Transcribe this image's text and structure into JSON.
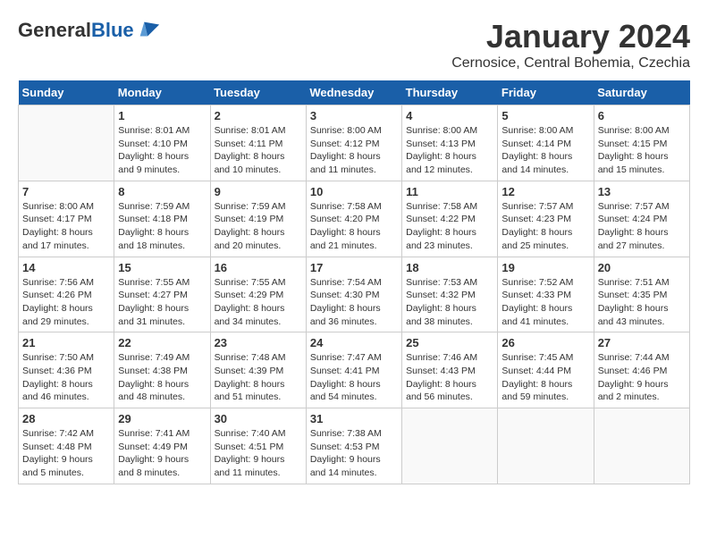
{
  "header": {
    "logo_line1": "General",
    "logo_line2": "Blue",
    "month": "January 2024",
    "location": "Cernosice, Central Bohemia, Czechia"
  },
  "days_of_week": [
    "Sunday",
    "Monday",
    "Tuesday",
    "Wednesday",
    "Thursday",
    "Friday",
    "Saturday"
  ],
  "weeks": [
    [
      {
        "day": "",
        "info": ""
      },
      {
        "day": "1",
        "info": "Sunrise: 8:01 AM\nSunset: 4:10 PM\nDaylight: 8 hours\nand 9 minutes."
      },
      {
        "day": "2",
        "info": "Sunrise: 8:01 AM\nSunset: 4:11 PM\nDaylight: 8 hours\nand 10 minutes."
      },
      {
        "day": "3",
        "info": "Sunrise: 8:00 AM\nSunset: 4:12 PM\nDaylight: 8 hours\nand 11 minutes."
      },
      {
        "day": "4",
        "info": "Sunrise: 8:00 AM\nSunset: 4:13 PM\nDaylight: 8 hours\nand 12 minutes."
      },
      {
        "day": "5",
        "info": "Sunrise: 8:00 AM\nSunset: 4:14 PM\nDaylight: 8 hours\nand 14 minutes."
      },
      {
        "day": "6",
        "info": "Sunrise: 8:00 AM\nSunset: 4:15 PM\nDaylight: 8 hours\nand 15 minutes."
      }
    ],
    [
      {
        "day": "7",
        "info": "Sunrise: 8:00 AM\nSunset: 4:17 PM\nDaylight: 8 hours\nand 17 minutes."
      },
      {
        "day": "8",
        "info": "Sunrise: 7:59 AM\nSunset: 4:18 PM\nDaylight: 8 hours\nand 18 minutes."
      },
      {
        "day": "9",
        "info": "Sunrise: 7:59 AM\nSunset: 4:19 PM\nDaylight: 8 hours\nand 20 minutes."
      },
      {
        "day": "10",
        "info": "Sunrise: 7:58 AM\nSunset: 4:20 PM\nDaylight: 8 hours\nand 21 minutes."
      },
      {
        "day": "11",
        "info": "Sunrise: 7:58 AM\nSunset: 4:22 PM\nDaylight: 8 hours\nand 23 minutes."
      },
      {
        "day": "12",
        "info": "Sunrise: 7:57 AM\nSunset: 4:23 PM\nDaylight: 8 hours\nand 25 minutes."
      },
      {
        "day": "13",
        "info": "Sunrise: 7:57 AM\nSunset: 4:24 PM\nDaylight: 8 hours\nand 27 minutes."
      }
    ],
    [
      {
        "day": "14",
        "info": "Sunrise: 7:56 AM\nSunset: 4:26 PM\nDaylight: 8 hours\nand 29 minutes."
      },
      {
        "day": "15",
        "info": "Sunrise: 7:55 AM\nSunset: 4:27 PM\nDaylight: 8 hours\nand 31 minutes."
      },
      {
        "day": "16",
        "info": "Sunrise: 7:55 AM\nSunset: 4:29 PM\nDaylight: 8 hours\nand 34 minutes."
      },
      {
        "day": "17",
        "info": "Sunrise: 7:54 AM\nSunset: 4:30 PM\nDaylight: 8 hours\nand 36 minutes."
      },
      {
        "day": "18",
        "info": "Sunrise: 7:53 AM\nSunset: 4:32 PM\nDaylight: 8 hours\nand 38 minutes."
      },
      {
        "day": "19",
        "info": "Sunrise: 7:52 AM\nSunset: 4:33 PM\nDaylight: 8 hours\nand 41 minutes."
      },
      {
        "day": "20",
        "info": "Sunrise: 7:51 AM\nSunset: 4:35 PM\nDaylight: 8 hours\nand 43 minutes."
      }
    ],
    [
      {
        "day": "21",
        "info": "Sunrise: 7:50 AM\nSunset: 4:36 PM\nDaylight: 8 hours\nand 46 minutes."
      },
      {
        "day": "22",
        "info": "Sunrise: 7:49 AM\nSunset: 4:38 PM\nDaylight: 8 hours\nand 48 minutes."
      },
      {
        "day": "23",
        "info": "Sunrise: 7:48 AM\nSunset: 4:39 PM\nDaylight: 8 hours\nand 51 minutes."
      },
      {
        "day": "24",
        "info": "Sunrise: 7:47 AM\nSunset: 4:41 PM\nDaylight: 8 hours\nand 54 minutes."
      },
      {
        "day": "25",
        "info": "Sunrise: 7:46 AM\nSunset: 4:43 PM\nDaylight: 8 hours\nand 56 minutes."
      },
      {
        "day": "26",
        "info": "Sunrise: 7:45 AM\nSunset: 4:44 PM\nDaylight: 8 hours\nand 59 minutes."
      },
      {
        "day": "27",
        "info": "Sunrise: 7:44 AM\nSunset: 4:46 PM\nDaylight: 9 hours\nand 2 minutes."
      }
    ],
    [
      {
        "day": "28",
        "info": "Sunrise: 7:42 AM\nSunset: 4:48 PM\nDaylight: 9 hours\nand 5 minutes."
      },
      {
        "day": "29",
        "info": "Sunrise: 7:41 AM\nSunset: 4:49 PM\nDaylight: 9 hours\nand 8 minutes."
      },
      {
        "day": "30",
        "info": "Sunrise: 7:40 AM\nSunset: 4:51 PM\nDaylight: 9 hours\nand 11 minutes."
      },
      {
        "day": "31",
        "info": "Sunrise: 7:38 AM\nSunset: 4:53 PM\nDaylight: 9 hours\nand 14 minutes."
      },
      {
        "day": "",
        "info": ""
      },
      {
        "day": "",
        "info": ""
      },
      {
        "day": "",
        "info": ""
      }
    ]
  ]
}
